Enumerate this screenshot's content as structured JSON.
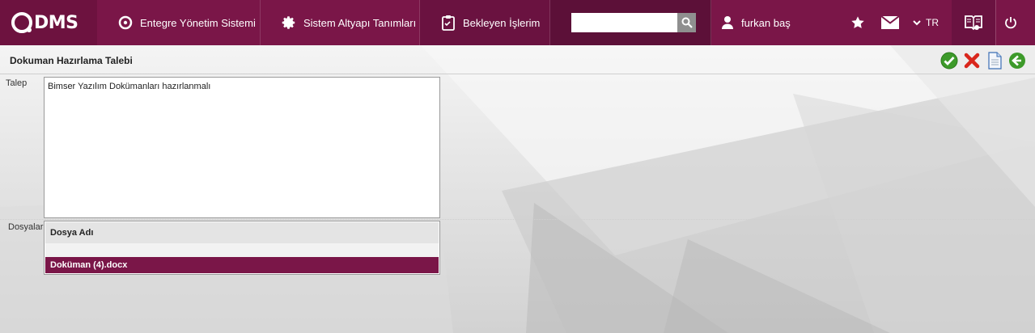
{
  "brand": {
    "logo_text": "DMS"
  },
  "nav": [
    {
      "label": "Entegre Yönetim Sistemi",
      "icon": "qdms-circle-icon"
    },
    {
      "label": "Sistem Altyapı Tanımları",
      "icon": "gear-icon"
    },
    {
      "label": "Bekleyen İşlerim",
      "icon": "clipboard-icon"
    }
  ],
  "search": {
    "value": "",
    "placeholder": ""
  },
  "user": {
    "name": "furkan baş"
  },
  "language": {
    "code": "TR"
  },
  "page": {
    "title": "Dokuman Hazırlama Talebi"
  },
  "form": {
    "talep_label": "Talep",
    "talep_value": "Bimser Yazılım Dokümanları hazırlanmalı",
    "dosyalar_label": "Dosyalar",
    "files_column": "Dosya Adı",
    "files": [
      {
        "name": "Doküman (4).docx"
      }
    ]
  },
  "colors": {
    "accent": "#7a1648",
    "accent_dark": "#6a1240",
    "selected_row": "#7a1648"
  }
}
